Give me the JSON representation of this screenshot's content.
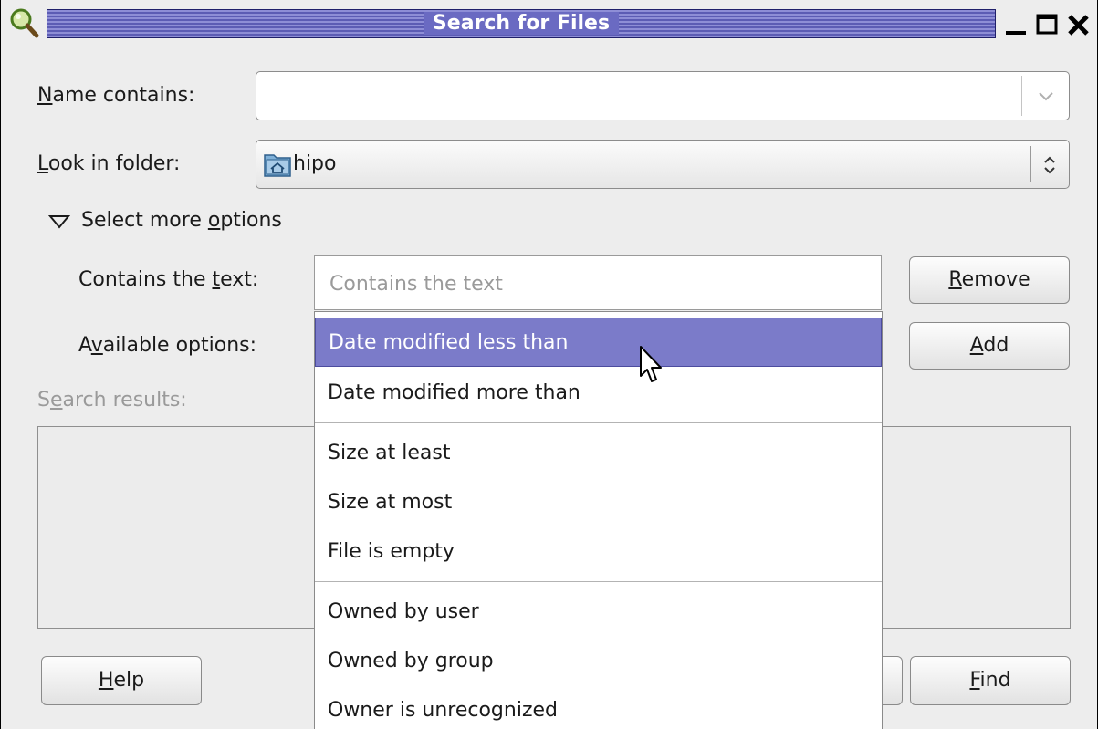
{
  "window": {
    "title": "Search for Files",
    "icons": {
      "app": "magnifier-icon",
      "minimize": "minimize-icon",
      "maximize": "maximize-icon",
      "close": "close-icon"
    }
  },
  "name_contains": {
    "label_underline": "N",
    "label_rest": "ame contains:",
    "value": ""
  },
  "look_in_folder": {
    "label_underline": "L",
    "label_rest": "ook in folder:",
    "value": "hipo"
  },
  "more_options": {
    "label_before": "Select more ",
    "label_underline": "o",
    "label_after": "ptions"
  },
  "contains_text": {
    "label_before": "Contains the ",
    "label_underline": "t",
    "label_after": "ext:",
    "placeholder": "Contains the text"
  },
  "available_options": {
    "label_before": "A",
    "label_underline": "v",
    "label_after": "ailable options:",
    "selected": "Date modified less than",
    "items": [
      "Date modified less than",
      "Date modified more than",
      "Size at least",
      "Size at most",
      "File is empty",
      "Owned by user",
      "Owned by group",
      "Owner is unrecognized"
    ]
  },
  "search_results": {
    "label_before": "S",
    "label_underline": "e",
    "label_after": "arch results:"
  },
  "buttons": {
    "remove_underline": "R",
    "remove_rest": "emove",
    "add_underline": "A",
    "add_rest": "dd",
    "help_underline": "H",
    "help_rest": "elp",
    "find_underline": "F",
    "find_rest": "ind"
  },
  "colors": {
    "selection": "#7b7bc9",
    "titlebar": "#6a6ac2"
  }
}
